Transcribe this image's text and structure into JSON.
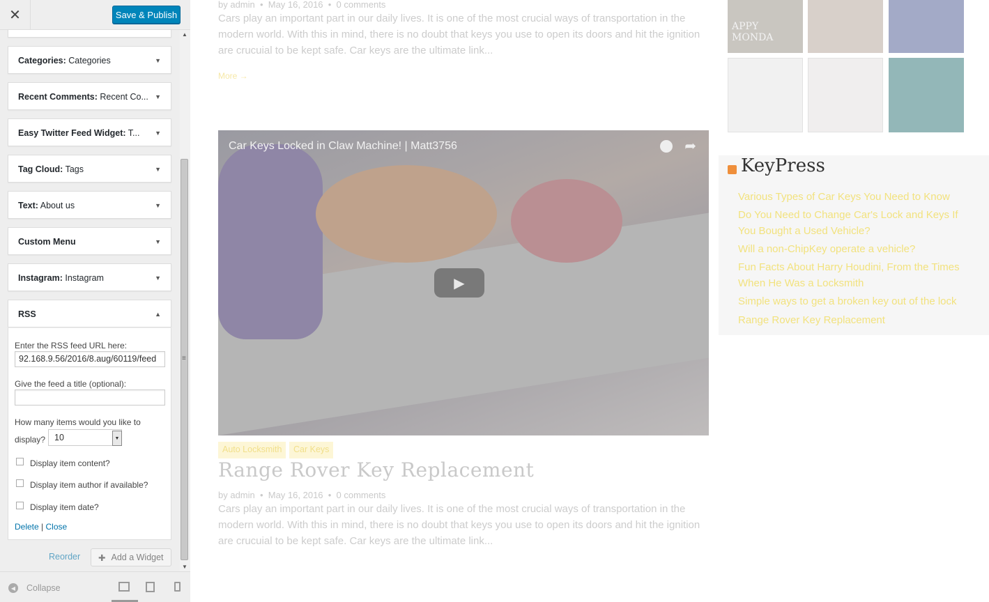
{
  "customizer": {
    "close_icon": "✕",
    "save_label": "Save & Publish",
    "widgets": [
      {
        "type": "Categories:",
        "name": "Categories"
      },
      {
        "type": "Recent Comments:",
        "name": "Recent Co..."
      },
      {
        "type": "Easy Twitter Feed Widget:",
        "name": "T..."
      },
      {
        "type": "Tag Cloud:",
        "name": "Tags"
      },
      {
        "type": "Text:",
        "name": "About us"
      },
      {
        "type": "Custom Menu",
        "name": ""
      },
      {
        "type": "Instagram:",
        "name": "Instagram"
      },
      {
        "type": "RSS",
        "name": ""
      }
    ],
    "rss_form": {
      "url_label": "Enter the RSS feed URL here:",
      "url_value": "92.168.9.56/2016/8.aug/60119/feed",
      "title_label": "Give the feed a title (optional):",
      "title_value": "",
      "count_label_1": "How many items would you like to",
      "count_label_2": "display?",
      "count_value": "10",
      "checkboxes": [
        {
          "label": "Display item content?",
          "checked": false
        },
        {
          "label": "Display item author if available?",
          "checked": false
        },
        {
          "label": "Display item date?",
          "checked": false
        }
      ],
      "delete_label": "Delete",
      "separator": "|",
      "close_label": "Close"
    },
    "reorder_label": "Reorder",
    "add_widget_label": "Add a Widget",
    "collapse_label": "Collapse"
  },
  "preview": {
    "post1": {
      "meta_author": "by admin",
      "meta_date": "May 16, 2016",
      "meta_comments": "0 comments",
      "excerpt": "Cars play an important part in our daily lives. It is one of the most crucial ways of transportation in the modern world. With this in mind, there is no doubt that keys you use to open its doors and hit the ignition are crucuial to be kept safe. Car keys are the ultimate link...",
      "more": "More →"
    },
    "video": {
      "title": "Car Keys Locked in Claw Machine! | Matt3756"
    },
    "post2": {
      "tags": [
        "Auto Locksmith",
        "Car Keys"
      ],
      "title": "Range Rover Key Replacement",
      "meta_author": "by admin",
      "meta_date": "May 16, 2016",
      "meta_comments": "0 comments",
      "excerpt": "Cars play an important part in our daily lives. It is one of the most crucial ways of transportation in the modern world. With this in mind, there is no doubt that keys you use to open its doors and hit the ignition are crucuial to be kept safe. Car keys are the ultimate link..."
    },
    "thumb_text": "APPY MONDA",
    "rss_widget": {
      "heading": "KeyPress",
      "items": [
        "Various Types of Car Keys You Need to Know",
        "Do You Need to Change Car's Lock and Keys If You Bought a Used Vehicle?",
        "Will a non-ChipKey operate a vehicle?",
        "Fun Facts About Harry Houdini, From the Times When He Was a Locksmith",
        "Simple ways to get a broken key out of the lock",
        "Range Rover Key Replacement"
      ]
    }
  },
  "colors": {
    "accent": "#0085ba",
    "link": "#0073aa",
    "rss_link": "#f2e27e"
  }
}
